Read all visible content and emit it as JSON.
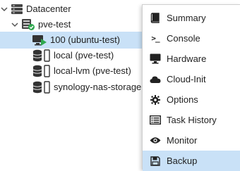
{
  "tree": {
    "items": [
      {
        "label": "Datacenter",
        "icon": "server-icon",
        "expander": "chevron-down-icon"
      },
      {
        "label": "pve-test",
        "icon": "node-online-icon",
        "expander": "chevron-down-icon"
      },
      {
        "label": "100 (ubuntu-test)",
        "icon": "vm-running-icon",
        "selected": true
      },
      {
        "label": "local (pve-test)",
        "icon": "storage-icon"
      },
      {
        "label": "local-lvm (pve-test)",
        "icon": "storage-icon"
      },
      {
        "label": "synology-nas-storage",
        "icon": "storage-icon"
      }
    ]
  },
  "menu": {
    "items": [
      {
        "label": "Summary",
        "icon": "book-icon"
      },
      {
        "label": "Console",
        "icon": "terminal-icon",
        "icon_text": ">_"
      },
      {
        "label": "Hardware",
        "icon": "desktop-icon"
      },
      {
        "label": "Cloud-Init",
        "icon": "cloud-icon"
      },
      {
        "label": "Options",
        "icon": "gear-icon"
      },
      {
        "label": "Task History",
        "icon": "list-icon"
      },
      {
        "label": "Monitor",
        "icon": "eye-icon"
      },
      {
        "label": "Backup",
        "icon": "save-icon",
        "active": true
      }
    ]
  },
  "colors": {
    "selection": "#c9e1f7",
    "status_green": "#2fa84f",
    "icon_dark": "#333333"
  }
}
